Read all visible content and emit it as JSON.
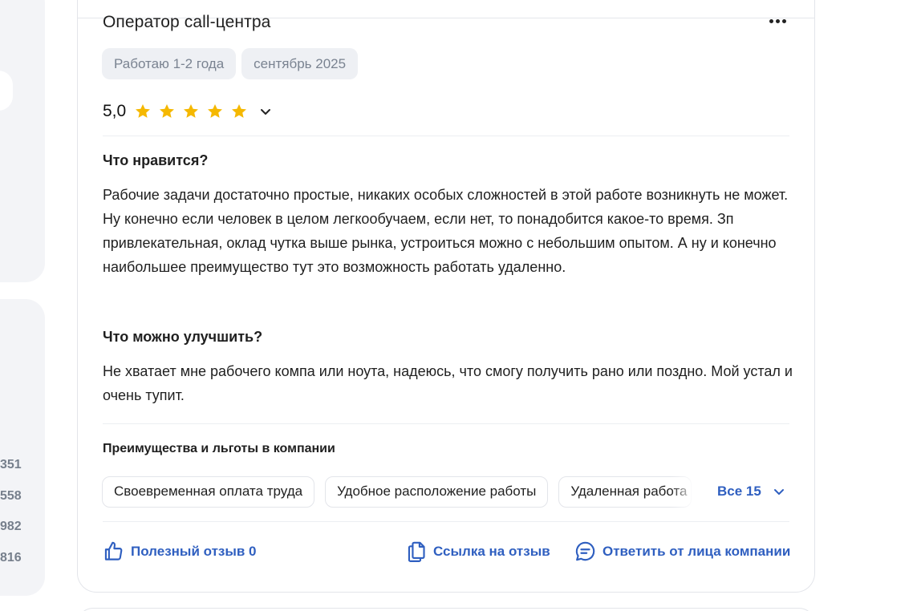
{
  "side": {
    "numbers": [
      "351",
      "558",
      "982",
      "816"
    ]
  },
  "review": {
    "title": "Оператор call-центра",
    "tags": [
      "Работаю 1-2 года",
      "сентябрь 2025"
    ],
    "rating": "5,0",
    "stars_filled": 5,
    "stars_total": 5,
    "likes_heading": "Что нравится?",
    "likes_text": "Рабочие задачи достаточно простые, никаких особых сложностей в этой работе возникнуть не может. Ну конечно если человек в целом легкообучаем, если нет, то понадобится какое-то время. Зп привлекательная, оклад чутка выше рынка, устроиться можно с небольшим опытом. А ну и конечно наибольшее преимущество тут это возможность работать удаленно.",
    "improve_heading": "Что можно улучшить?",
    "improve_text": "Не хватает мне рабочего компа или ноута, надеюсь, что смогу получить рано или поздно. Мой устал и очень тупит.",
    "benefits_heading": "Преимущества и льготы в компании",
    "benefits": [
      "Своевременная оплата труда",
      "Удобное расположение работы",
      "Удаленная работа"
    ],
    "benefits_all": "Все 15",
    "actions": {
      "helpful": "Полезный отзыв 0",
      "link": "Ссылка на отзыв",
      "reply": "Ответить от лица компании"
    }
  },
  "colors": {
    "accent": "#2f5fc0",
    "star": "#f5b800",
    "chip_bg": "#eef0f4",
    "muted_text": "#7a8391"
  },
  "icons": [
    "more-icon",
    "star-icon",
    "chevron-down-icon",
    "thumbs-up-icon",
    "copy-link-icon",
    "comment-icon"
  ]
}
